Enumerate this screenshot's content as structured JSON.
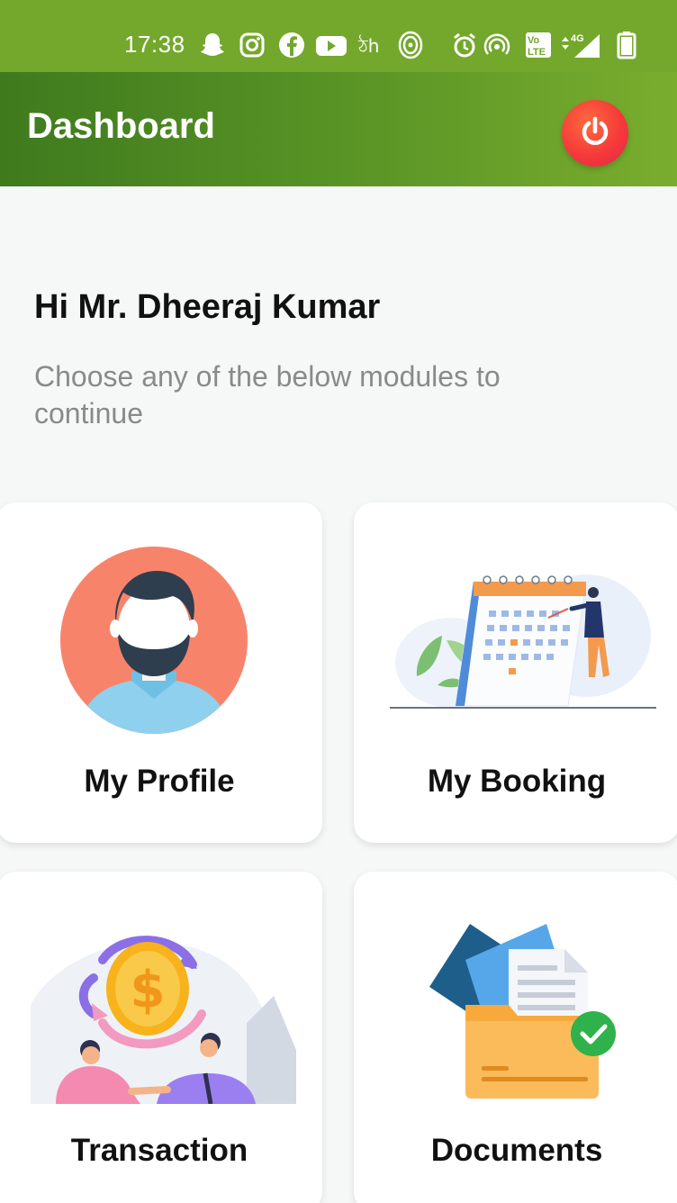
{
  "status_bar": {
    "time": "17:38",
    "network_label": "4G",
    "volte_label": "Vo LTE",
    "icons": [
      "snapchat-icon",
      "instagram-icon",
      "facebook-icon",
      "youtube-icon",
      "app-icon",
      "wifi-hotspot-icon",
      "alarm-icon",
      "broadcast-icon",
      "volte-icon",
      "signal-icon",
      "battery-icon"
    ]
  },
  "app_bar": {
    "title": "Dashboard",
    "power_icon": "power-icon"
  },
  "greeting": {
    "title": "Hi Mr. Dheeraj Kumar",
    "subtitle": "Choose any of the below modules to continue"
  },
  "modules": [
    {
      "label": "My Profile",
      "icon": "profile-avatar-illustration"
    },
    {
      "label": "My Booking",
      "icon": "calendar-booking-illustration"
    },
    {
      "label": "Transaction",
      "icon": "coin-exchange-illustration"
    },
    {
      "label": "Documents",
      "icon": "documents-folder-illustration"
    }
  ],
  "colors": {
    "status_bar": "#74a82c",
    "app_bar_start": "#3f7a1e",
    "app_bar_end": "#7aad2e",
    "power_button": "#f53a3a",
    "background": "#f6f7f7"
  }
}
